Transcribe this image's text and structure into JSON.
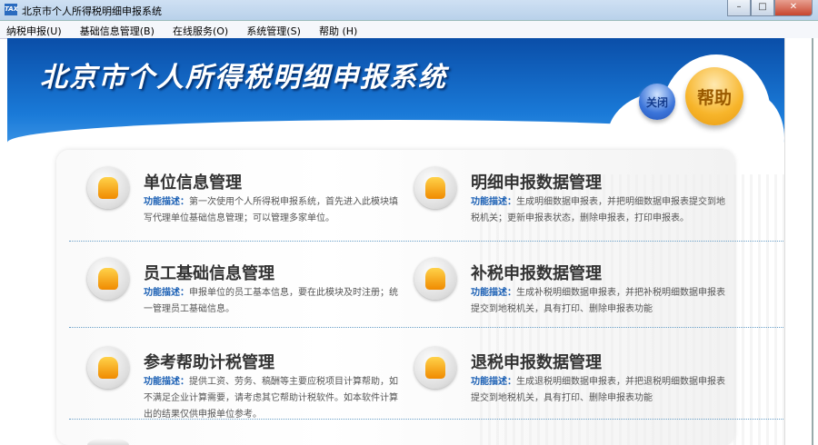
{
  "window": {
    "title": "北京市个人所得税明细申报系统",
    "icon_text": "TAX",
    "controls": [
      "minimize-icon",
      "maximize-icon",
      "close-icon"
    ]
  },
  "menu": [
    "纳税申报(U)",
    "基础信息管理(B)",
    "在线服务(O)",
    "系统管理(S)",
    "帮助 (H)"
  ],
  "banner": {
    "title": "北京市个人所得税明细申报系统",
    "close_label": "关闭",
    "help_label": "帮助"
  },
  "desc_label": "功能描述：",
  "items": [
    {
      "title": "单位信息管理",
      "desc": "第一次使用个人所得税申报系统，首先进入此模块填写代理单位基础信息管理；可以管理多家单位。"
    },
    {
      "title": "明细申报数据管理",
      "desc": "生成明细数据申报表，并把明细数据申报表提交到地税机关；更新申报表状态，删除申报表，打印申报表。"
    },
    {
      "title": "员工基础信息管理",
      "desc": "申报单位的员工基本信息，要在此模块及时注册；统一管理员工基础信息。"
    },
    {
      "title": "补税申报数据管理",
      "desc": "生成补税明细数据申报表，并把补税明细数据申报表提交到地税机关，具有打印、删除申报表功能"
    },
    {
      "title": "参考帮助计税管理",
      "desc": "提供工资、劳务、稿酬等主要应税项目计算帮助，如不满足企业计算需要，请考虑其它帮助计税软件。如本软件计算出的结果仅供申报单位参考。"
    },
    {
      "title": "退税申报数据管理",
      "desc": "生成退税明细数据申报表，并把退税明细数据申报表提交到地税机关，具有打印、删除申报表功能"
    }
  ]
}
